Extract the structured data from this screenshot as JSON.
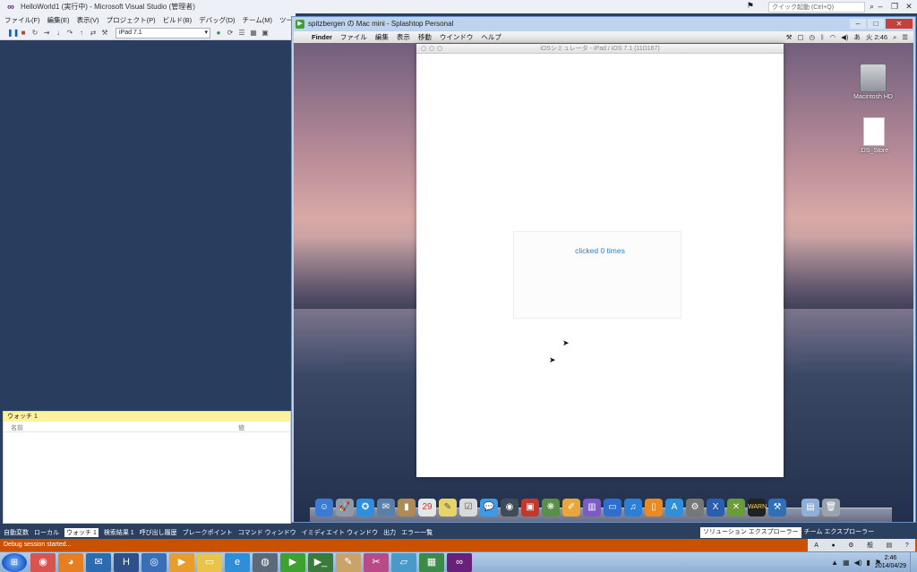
{
  "vs": {
    "title": "HelloWorld1 (実行中) - Microsoft Visual Studio (管理者)",
    "quick_launch_placeholder": "クイック起動 (Ctrl+Q)",
    "menu": [
      "ファイル(F)",
      "編集(E)",
      "表示(V)",
      "プロジェクト(P)",
      "ビルド(B)",
      "デバッグ(D)",
      "チーム(M)",
      "ツール"
    ],
    "device": "iPad 7.1",
    "watch": {
      "title": "ウォッチ 1",
      "col_name": "名前",
      "col_value": "値"
    },
    "bottom_tabs": [
      "自動変数",
      "ローカル",
      "ウォッチ 1",
      "検索結果 1",
      "呼び出し履歴",
      "ブレークポイント",
      "コマンド ウィンドウ",
      "イミディエイト ウィンドウ",
      "出力",
      "エラー一覧"
    ],
    "side_tabs": [
      "ソリューション エクスプローラー",
      "チーム エクスプローラー"
    ],
    "status": "Debug session started..."
  },
  "splashtop": {
    "title": "spitzbergen の Mac mini - Splashtop Personal"
  },
  "mac": {
    "menu": [
      "Finder",
      "ファイル",
      "編集",
      "表示",
      "移動",
      "ウインドウ",
      "ヘルプ"
    ],
    "status_time": "火 2:46",
    "simulator_title": "iOSシミュレータ - iPad / iOS 7.1 (11D167)",
    "label_text": "clicked 0 times",
    "desktop_icons": [
      "Macintosh HD",
      ".DS_Store"
    ]
  },
  "taskbar": {
    "time": "2:46",
    "date": "2014/04/29"
  },
  "colors": {
    "vs_accent": "#68217a",
    "status_bar": "#ca5100",
    "ios_link": "#2c7ed6"
  }
}
